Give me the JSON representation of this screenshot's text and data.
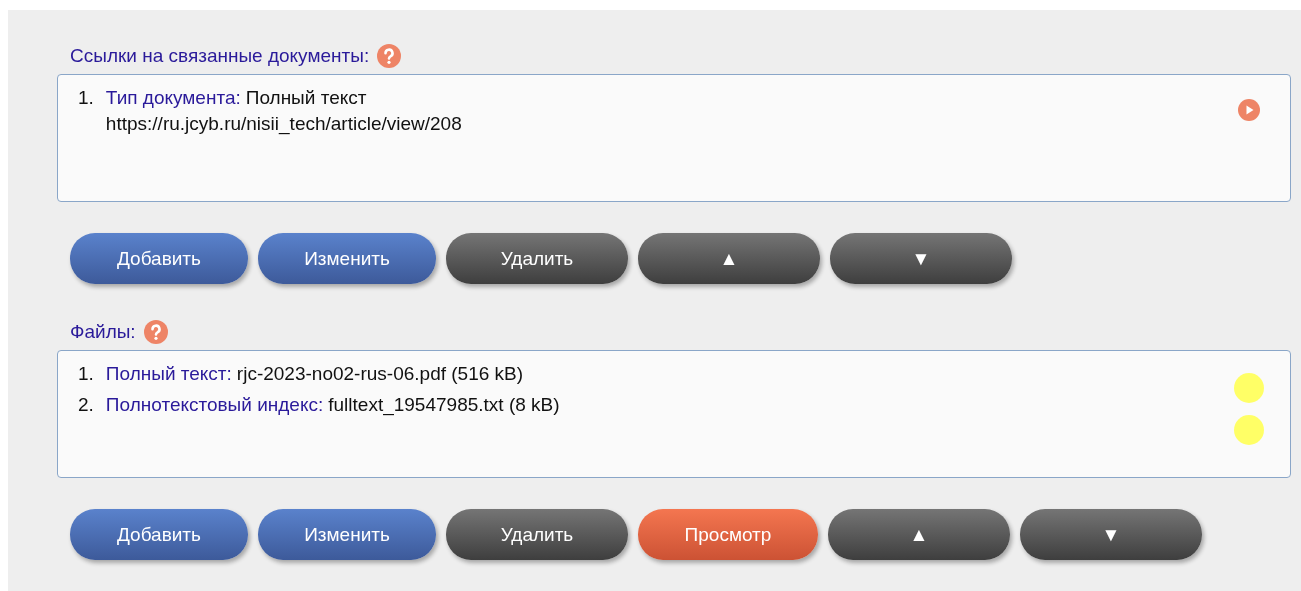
{
  "sections": [
    {
      "label": "Ссылки на связанные документы:",
      "kind": "links",
      "items": [
        {
          "number": "1.",
          "key": "Тип документа:",
          "value": "Полный текст",
          "extra": "https://ru.jcyb.ru/nisii_tech/article/view/208"
        }
      ],
      "buttons": [
        {
          "label": "Добавить",
          "kind": "primary"
        },
        {
          "label": "Изменить",
          "kind": "primary"
        },
        {
          "label": "Удалить",
          "kind": "dark"
        },
        {
          "label": "▲",
          "kind": "dark"
        },
        {
          "label": "▼",
          "kind": "dark"
        }
      ]
    },
    {
      "label": "Файлы:",
      "kind": "files",
      "items": [
        {
          "number": "1.",
          "key": "Полный текст:",
          "value": "rjc-2023-no02-rus-06.pdf (516 kB)",
          "color": "#ffff66"
        },
        {
          "number": "2.",
          "key": "Полнотекстовый индекс:",
          "value": "fulltext_19547985.txt (8 kB)",
          "color": "#ffff66"
        }
      ],
      "buttons": [
        {
          "label": "Добавить",
          "kind": "primary"
        },
        {
          "label": "Изменить",
          "kind": "primary"
        },
        {
          "label": "Удалить",
          "kind": "dark"
        },
        {
          "label": "Просмотр",
          "kind": "accent"
        },
        {
          "label": "▲",
          "kind": "dark"
        },
        {
          "label": "▼",
          "kind": "dark"
        }
      ]
    }
  ]
}
